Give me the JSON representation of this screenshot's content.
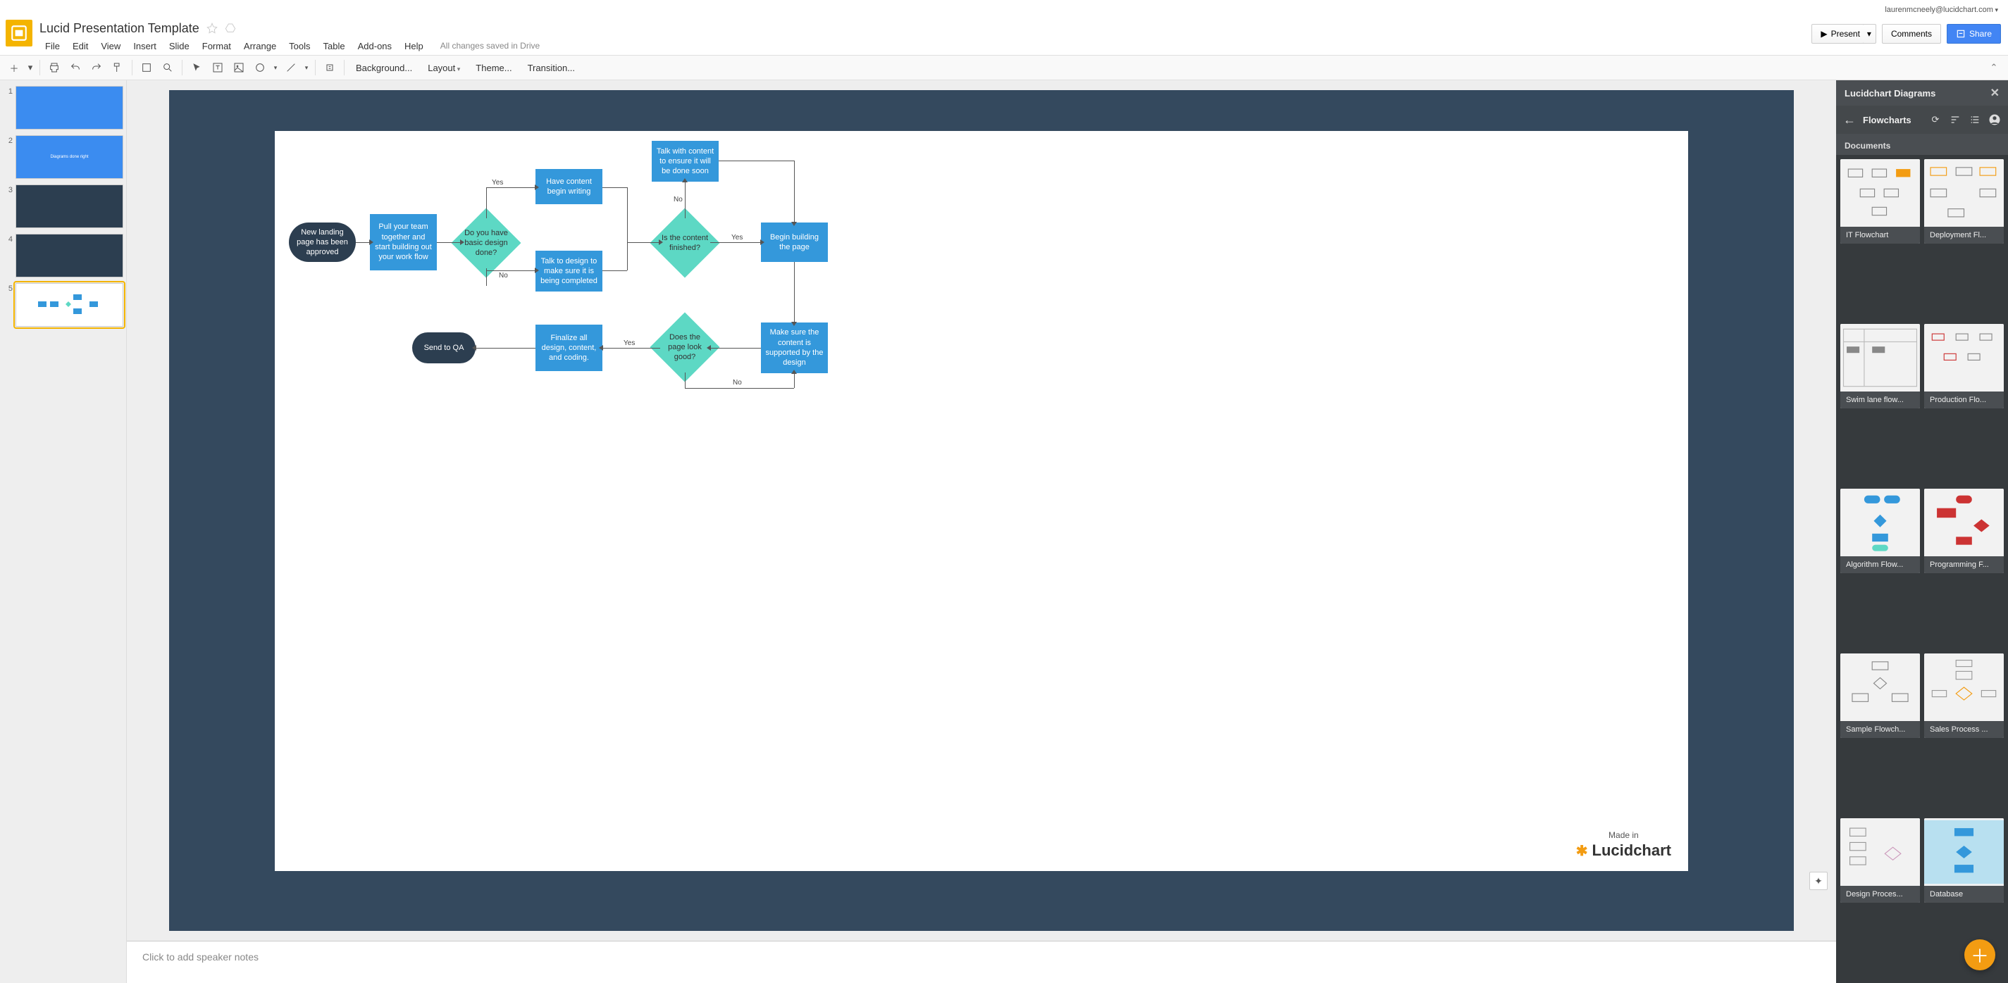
{
  "user_email": "laurenmcneely@lucidchart.com",
  "doc_title": "Lucid Presentation Template",
  "menu": [
    "File",
    "Edit",
    "View",
    "Insert",
    "Slide",
    "Format",
    "Arrange",
    "Tools",
    "Table",
    "Add-ons",
    "Help"
  ],
  "save_status": "All changes saved in Drive",
  "header_buttons": {
    "present": "Present",
    "comments": "Comments",
    "share": "Share"
  },
  "toolbar_text": {
    "background": "Background...",
    "layout": "Layout",
    "theme": "Theme...",
    "transition": "Transition..."
  },
  "filmstrip": {
    "slides": [
      {
        "num": "1",
        "bg": "blue"
      },
      {
        "num": "2",
        "bg": "blue",
        "caption": "Diagrams done right"
      },
      {
        "num": "3",
        "bg": "dark"
      },
      {
        "num": "4",
        "bg": "dark"
      },
      {
        "num": "5",
        "bg": "white",
        "selected": true
      }
    ]
  },
  "speaker_notes_placeholder": "Click to add speaker notes",
  "side_panel": {
    "header": "Lucidchart Diagrams",
    "breadcrumb": "Flowcharts",
    "section": "Documents",
    "docs": [
      "IT Flowchart",
      "Deployment Fl...",
      "Swim lane flow...",
      "Production Flo...",
      "Algorithm Flow...",
      "Programming F...",
      "Sample Flowch...",
      "Sales Process ...",
      "Design Proces...",
      "Database"
    ]
  },
  "flowchart": {
    "start": "New landing page has been approved",
    "pull": "Pull your team together and start building out your work flow",
    "design_q": "Do you have basic design done?",
    "yes": "Yes",
    "no": "No",
    "content_write": "Have content begin writing",
    "talk_design": "Talk to design to make sure it is being completed",
    "talk_content": "Talk with content to ensure it will be done soon",
    "content_q": "Is the content finished?",
    "build": "Begin building the page",
    "support": "Make sure the content is supported by the design",
    "look_q": "Does the page look good?",
    "finalize": "Finalize all design, content, and coding.",
    "qa": "Send to QA",
    "madein": "Made in",
    "brand": "Lucidchart"
  }
}
